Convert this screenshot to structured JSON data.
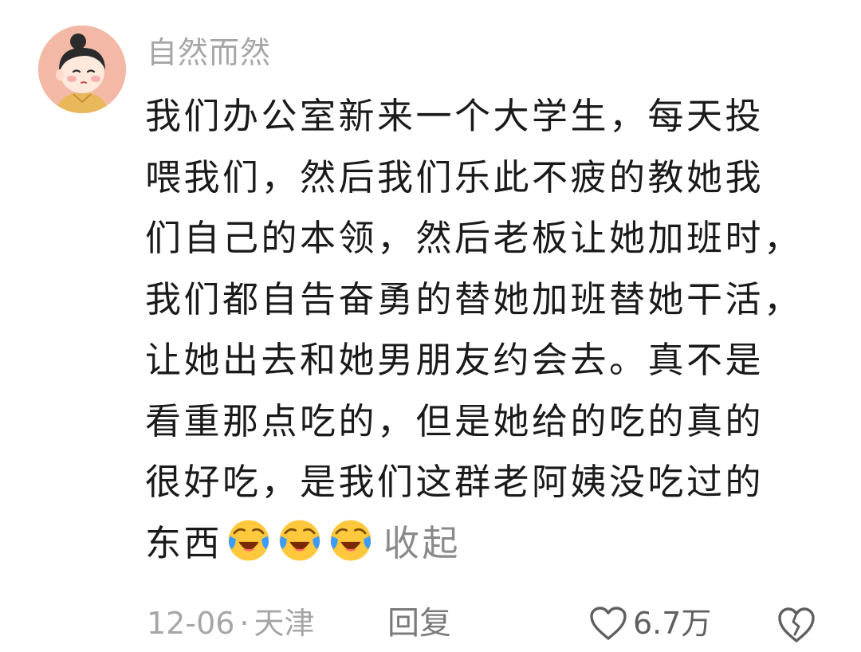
{
  "comment": {
    "username": "自然而然",
    "content_lines": [
      "我们办公室新来一个大学生，每天投",
      "喂我们，然后我们乐此不疲的教她我",
      "们自己的本领，然后老板让她加班时，",
      "我们都自告奋勇的替她加班替她干活，",
      "让她出去和她男朋友约会去。真不是",
      "看重那点吃的，但是她给的吃的真的",
      "很好吃，是我们这群老阿姨没吃过的",
      "东西"
    ],
    "emojis": [
      "laughing-crying-emoji",
      "laughing-crying-emoji",
      "laughing-crying-emoji"
    ],
    "collapse_label": "收起",
    "date": "12-06",
    "separator": "·",
    "location": "天津",
    "reply_label": "回复",
    "like_count": "6.7万"
  },
  "icons": {
    "like": "heart-outline-icon",
    "dislike": "broken-heart-icon"
  },
  "colors": {
    "text": "#1a1a1a",
    "muted": "#a6a6a6",
    "emoji_face": "#ffc83d",
    "emoji_tears": "#3b9bff"
  }
}
